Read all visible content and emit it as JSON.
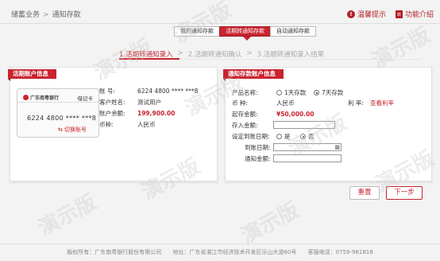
{
  "header": {
    "breadcrumb": [
      "储蓄业务",
      "通知存款"
    ],
    "links": [
      "温馨提示",
      "功能介绍"
    ]
  },
  "tabs": [
    {
      "label": "我的通知存款",
      "active": false
    },
    {
      "label": "活期转通知存款",
      "active": true
    },
    {
      "label": "自动通知存款",
      "active": false
    }
  ],
  "steps": [
    "1.活期转通知录入",
    "2.活期转通知确认",
    "3.活期转通知录入结果"
  ],
  "left_panel": {
    "title": "活期账户信息",
    "card": {
      "bank_name": "广东南粤银行",
      "type": "借记卡",
      "number": "6224 4800 **** ***8",
      "switch_label": "切换账号"
    },
    "rows": [
      {
        "key": "账 号:",
        "value": "6224 4800 **** ***8"
      },
      {
        "key": "客户姓名:",
        "value": "测试用户"
      },
      {
        "key": "账户余额:",
        "value": "199,900.00",
        "highlight": true
      },
      {
        "key": "币种:",
        "value": "人民币"
      }
    ]
  },
  "right_panel": {
    "title": "通知存款账户信息",
    "product_label": "产品名称:",
    "product_options": [
      {
        "label": "1天存款",
        "selected": false
      },
      {
        "label": "7天存款",
        "selected": true
      }
    ],
    "currency_label": "币 种:",
    "currency_value": "人民币",
    "rate_label": "利 率:",
    "rate_link": "查看利率",
    "min_label": "起存金额:",
    "min_value": "¥50,000.00",
    "amount_label": "存入金额:",
    "amount_value": "",
    "due_label": "设定到账日期:",
    "due_options": [
      {
        "label": "是",
        "selected": false
      },
      {
        "label": "否",
        "selected": true
      }
    ],
    "due_date_label": "到账日期:",
    "notice_amount_label": "通知金额:"
  },
  "buttons": {
    "reset": "重置",
    "next": "下一步"
  },
  "footer": {
    "copyright": "版权所有：广东南粤银行股份有限公司",
    "address": "地址：广东省湛江市经济技术开发区乐山大道60号",
    "hotline": "客服电话：0759-961818"
  },
  "watermark": "演示版",
  "colors": {
    "accent": "#c9242f"
  },
  "icons": {
    "tips": "info-icon",
    "intro": "book-icon",
    "calendar": "calendar-icon",
    "switch": "swap-icon"
  }
}
